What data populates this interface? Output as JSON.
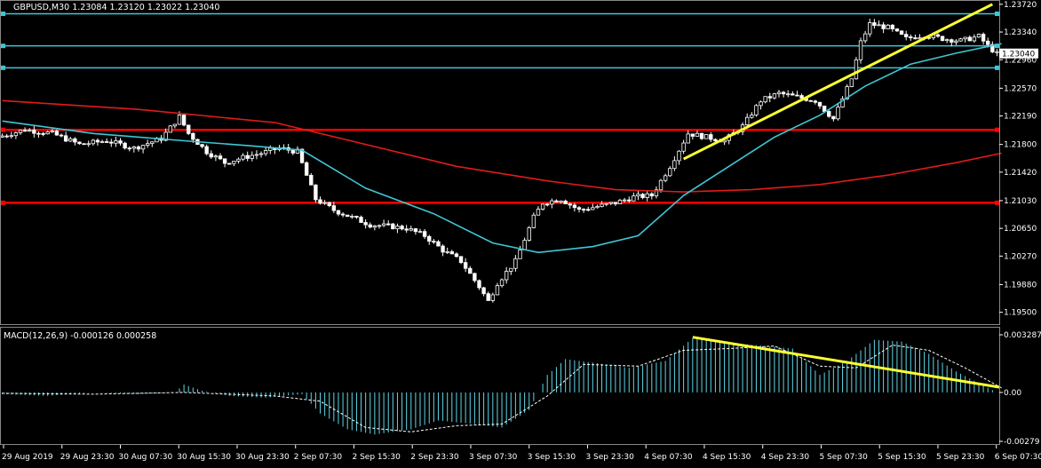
{
  "window": {
    "symbol_title": "GBPUSD,M30  1.23084 1.23120 1.23022 1.23040",
    "current_price_label": "1.23040",
    "macd_title": "MACD(12,26,9) -0.000126 0.000258"
  },
  "colors": {
    "background": "#000000",
    "bull_candle": "#000000",
    "bear_candle": "#ffffff",
    "candle_outline": "#ffffff",
    "ma_fast": "#3fc6d6",
    "ma_slow": "#e01b1b",
    "horizontal_red": "#ff0000",
    "horizontal_cyan": "#3fc6d6",
    "trendline": "#ffff33",
    "macd_hist": "#5fd7e8",
    "macd_signal": "#ffffff",
    "grid_text": "#ffffff",
    "price_tag_bg": "#ffffff",
    "price_tag_text": "#000000"
  },
  "chart_data": [
    {
      "type": "candlestick",
      "title": "GBPUSD,M30  1.23084 1.23120 1.23022 1.23040",
      "ylim": [
        1.1935,
        1.2373
      ],
      "y_ticks": [
        "1.23720",
        "1.23340",
        "1.22960",
        "1.22570",
        "1.22190",
        "1.21800",
        "1.21420",
        "1.21030",
        "1.20650",
        "1.20270",
        "1.19880",
        "1.19500"
      ],
      "x_ticks": [
        "29 Aug 2019",
        "29 Aug 23:30",
        "30 Aug 07:30",
        "30 Aug 15:30",
        "30 Aug 23:30",
        "2 Sep 07:30",
        "2 Sep 15:30",
        "2 Sep 23:30",
        "3 Sep 07:30",
        "3 Sep 15:30",
        "3 Sep 23:30",
        "4 Sep 07:30",
        "4 Sep 15:30",
        "4 Sep 23:30",
        "5 Sep 07:30",
        "5 Sep 15:30",
        "5 Sep 23:30",
        "6 Sep 07:30"
      ],
      "current_price": 1.2304,
      "price_path": [
        [
          0,
          1.219
        ],
        [
          6,
          1.22
        ],
        [
          12,
          1.2195
        ],
        [
          18,
          1.218
        ],
        [
          24,
          1.2185
        ],
        [
          30,
          1.2175
        ],
        [
          36,
          1.2188
        ],
        [
          40,
          1.2218
        ],
        [
          42,
          1.2195
        ],
        [
          46,
          1.217
        ],
        [
          50,
          1.2155
        ],
        [
          54,
          1.2162
        ],
        [
          58,
          1.2168
        ],
        [
          62,
          1.2175
        ],
        [
          66,
          1.217
        ],
        [
          70,
          1.2105
        ],
        [
          74,
          1.209
        ],
        [
          78,
          1.208
        ],
        [
          82,
          1.207
        ],
        [
          86,
          1.2068
        ],
        [
          90,
          1.2065
        ],
        [
          94,
          1.2055
        ],
        [
          98,
          1.2035
        ],
        [
          102,
          1.202
        ],
        [
          106,
          1.1985
        ],
        [
          108,
          1.1965
        ],
        [
          110,
          1.199
        ],
        [
          114,
          1.202
        ],
        [
          118,
          1.208
        ],
        [
          120,
          1.21
        ],
        [
          124,
          1.2105
        ],
        [
          128,
          1.209
        ],
        [
          132,
          1.2095
        ],
        [
          136,
          1.21
        ],
        [
          140,
          1.2108
        ],
        [
          144,
          1.211
        ],
        [
          148,
          1.215
        ],
        [
          152,
          1.2195
        ],
        [
          156,
          1.219
        ],
        [
          160,
          1.2185
        ],
        [
          164,
          1.2205
        ],
        [
          168,
          1.224
        ],
        [
          172,
          1.225
        ],
        [
          176,
          1.2245
        ],
        [
          180,
          1.224
        ],
        [
          184,
          1.2215
        ],
        [
          188,
          1.227
        ],
        [
          190,
          1.232
        ],
        [
          192,
          1.2345
        ],
        [
          196,
          1.234
        ],
        [
          200,
          1.2325
        ],
        [
          204,
          1.233
        ],
        [
          208,
          1.2325
        ],
        [
          212,
          1.2322
        ],
        [
          216,
          1.2328
        ],
        [
          218,
          1.2315
        ],
        [
          220,
          1.2304
        ]
      ],
      "bars_total": 220,
      "ma_fast": [
        [
          0,
          1.2212
        ],
        [
          20,
          1.2195
        ],
        [
          40,
          1.2185
        ],
        [
          55,
          1.2178
        ],
        [
          66,
          1.2172
        ],
        [
          80,
          1.212
        ],
        [
          95,
          1.2085
        ],
        [
          108,
          1.2045
        ],
        [
          118,
          1.2032
        ],
        [
          130,
          1.204
        ],
        [
          140,
          1.2055
        ],
        [
          150,
          1.211
        ],
        [
          160,
          1.215
        ],
        [
          170,
          1.219
        ],
        [
          180,
          1.222
        ],
        [
          190,
          1.226
        ],
        [
          200,
          1.229
        ],
        [
          210,
          1.2305
        ],
        [
          220,
          1.2318
        ]
      ],
      "ma_slow": [
        [
          0,
          1.224
        ],
        [
          30,
          1.2228
        ],
        [
          60,
          1.221
        ],
        [
          80,
          1.218
        ],
        [
          100,
          1.215
        ],
        [
          120,
          1.213
        ],
        [
          135,
          1.2118
        ],
        [
          150,
          1.2115
        ],
        [
          165,
          1.2118
        ],
        [
          180,
          1.2125
        ],
        [
          195,
          1.2138
        ],
        [
          210,
          1.2155
        ],
        [
          220,
          1.2168
        ]
      ],
      "horizontal_lines": [
        {
          "price": 1.2359,
          "color": "cyan"
        },
        {
          "price": 1.2315,
          "color": "cyan"
        },
        {
          "price": 1.2285,
          "color": "cyan"
        },
        {
          "price": 1.22,
          "color": "red"
        },
        {
          "price": 1.21,
          "color": "red"
        }
      ],
      "trendline": {
        "from": [
          150,
          1.216
        ],
        "to": [
          218,
          1.2372
        ]
      }
    },
    {
      "type": "histogram",
      "title": "MACD(12,26,9) -0.000126 0.000258",
      "ylim": [
        -0.00279,
        0.003287
      ],
      "y_ticks": [
        "0.003287",
        "0.00",
        "-0.00279"
      ],
      "macd_path": [
        [
          0,
          -0.0001
        ],
        [
          10,
          -0.0002
        ],
        [
          20,
          0.0
        ],
        [
          30,
          -0.0001
        ],
        [
          38,
          0.0
        ],
        [
          40,
          0.00045
        ],
        [
          44,
          0.0001
        ],
        [
          50,
          -0.0002
        ],
        [
          58,
          -0.0003
        ],
        [
          66,
          -0.0001
        ],
        [
          70,
          -0.0012
        ],
        [
          76,
          -0.0021
        ],
        [
          82,
          -0.0024
        ],
        [
          90,
          -0.0021
        ],
        [
          96,
          -0.0016
        ],
        [
          104,
          -0.0018
        ],
        [
          110,
          -0.002
        ],
        [
          116,
          -0.001
        ],
        [
          120,
          0.001
        ],
        [
          124,
          0.0019
        ],
        [
          130,
          0.0017
        ],
        [
          138,
          0.0014
        ],
        [
          146,
          0.0018
        ],
        [
          152,
          0.0031
        ],
        [
          158,
          0.00285
        ],
        [
          166,
          0.0027
        ],
        [
          174,
          0.0025
        ],
        [
          180,
          0.001
        ],
        [
          186,
          0.0018
        ],
        [
          192,
          0.003
        ],
        [
          198,
          0.0029
        ],
        [
          204,
          0.0022
        ],
        [
          210,
          0.0012
        ],
        [
          216,
          0.0004
        ],
        [
          220,
          -0.00013
        ]
      ],
      "signal_path": [
        [
          0,
          -5e-05
        ],
        [
          20,
          -0.0001
        ],
        [
          40,
          0.0
        ],
        [
          60,
          -0.0002
        ],
        [
          70,
          -0.0005
        ],
        [
          80,
          -0.002
        ],
        [
          90,
          -0.00225
        ],
        [
          100,
          -0.0019
        ],
        [
          110,
          -0.0018
        ],
        [
          120,
          -0.0002
        ],
        [
          128,
          0.0016
        ],
        [
          140,
          0.0015
        ],
        [
          150,
          0.0024
        ],
        [
          160,
          0.0025
        ],
        [
          170,
          0.00265
        ],
        [
          180,
          0.0015
        ],
        [
          188,
          0.0014
        ],
        [
          196,
          0.0027
        ],
        [
          204,
          0.0024
        ],
        [
          212,
          0.0014
        ],
        [
          220,
          0.00026
        ]
      ],
      "trendline": {
        "from": [
          152,
          0.00315
        ],
        "to": [
          220,
          0.0003
        ]
      }
    }
  ]
}
